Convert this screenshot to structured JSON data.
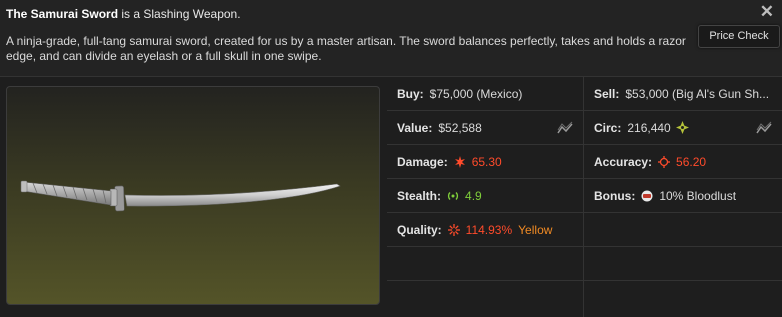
{
  "header": {
    "item_name": "The Samurai Sword",
    "item_type_suffix": " is a Slashing Weapon.",
    "description": "A ninja-grade, full-tang samurai sword, created for us by a master artisan. The sword balances perfectly, takes and holds a razor edge, and can divide an eyelash or a full skull in one swipe.",
    "close_icon": "close-icon",
    "price_check_label": "Price Check"
  },
  "stats": {
    "buy": {
      "label": "Buy:",
      "value": "$75,000 (Mexico)"
    },
    "sell": {
      "label": "Sell:",
      "value": "$53,000 (Big Al's Gun Sh..."
    },
    "value": {
      "label": "Value:",
      "value": "$52,588"
    },
    "circ": {
      "label": "Circ:",
      "value": "216,440"
    },
    "damage": {
      "label": "Damage:",
      "value": "65.30",
      "icon": "damage-icon",
      "color": "#ff4b2b"
    },
    "accuracy": {
      "label": "Accuracy:",
      "value": "56.20",
      "icon": "accuracy-icon",
      "color": "#ff4b2b"
    },
    "stealth": {
      "label": "Stealth:",
      "value": "4.9",
      "icon": "stealth-icon",
      "color": "#7fce3a"
    },
    "bonus": {
      "label": "Bonus:",
      "value": "10% Bloodlust",
      "icon": "bloodlust-icon"
    },
    "quality": {
      "label": "Quality:",
      "value": "114.93%",
      "tier": "Yellow",
      "icon": "quality-icon",
      "color": "#ff4b2b",
      "tier_color": "#f08a24"
    }
  },
  "icons": {
    "trend": "trend-chart-icon",
    "circulation": "shuriken-icon"
  }
}
